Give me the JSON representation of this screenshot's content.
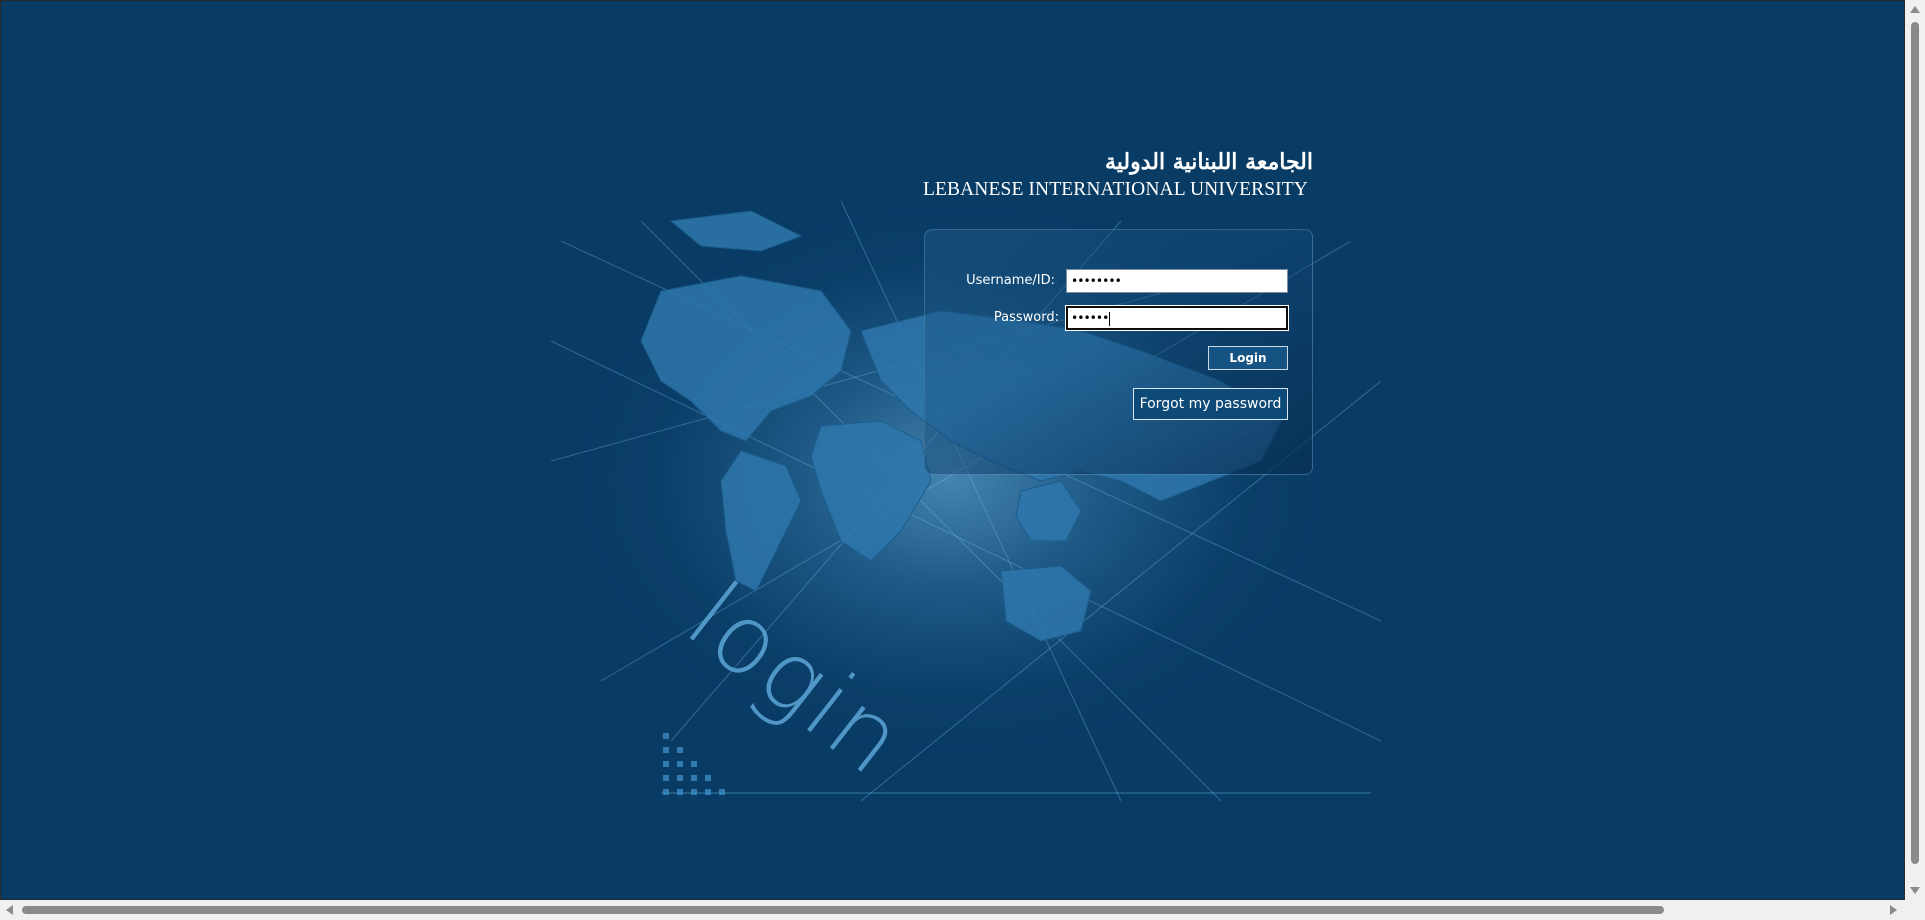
{
  "brand": {
    "arabic_name": "الجامعة اللبنانية الدولية",
    "english_name": "LEBANESE INTERNATIONAL UNIVERSITY"
  },
  "background_word": "login",
  "form": {
    "username_label": "Username/ID:",
    "username_value": "••••••••",
    "password_label": "Password:",
    "password_value": "••••••",
    "login_label": "Login",
    "forgot_label": "Forgot my password"
  },
  "colors": {
    "page_background": "#083c65",
    "button": "#155482",
    "accent_text": "#64afe1"
  }
}
